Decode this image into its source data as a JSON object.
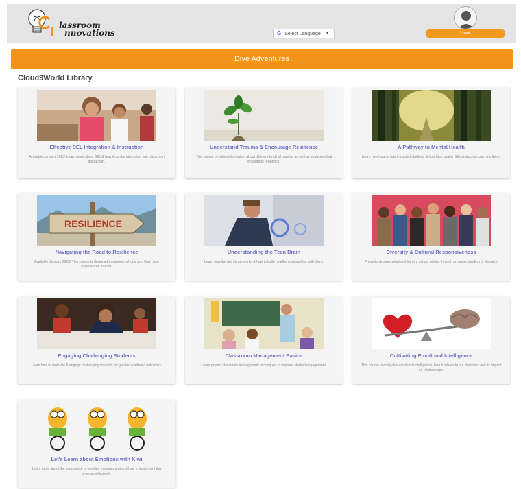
{
  "header": {
    "logo_text_line1": "lassroom",
    "logo_text_line2": "nnovations",
    "language_label": "Select Language",
    "language_caret": "▼",
    "language_icon_letter": "G",
    "user_button_label": "User"
  },
  "banner": {
    "label": "Dive Adventures"
  },
  "library": {
    "title": "Cloud9World Library"
  },
  "courses": [
    {
      "title": "Effective SEL Integration & Instruction",
      "description": "Available January 2023! Learn more about SEL & how it can be integrated into classroom instruction."
    },
    {
      "title": "Understand Trauma & Encourage Resilience",
      "description": "This course provides information about different kinds of trauma, as well as strategies that encourage resilience."
    },
    {
      "title": "A Pathway to Mental Health",
      "description": "Learn how trauma has impacted students & how high quality SEL instruction can help them."
    },
    {
      "title": "Navigating the Road to Resilience",
      "description": "Available January 2023! This course is designed to support schools and they have experienced trauma."
    },
    {
      "title": "Understanding the Teen Brain",
      "description": "Learn how the teen brain works & how to build healthy relationships with them."
    },
    {
      "title": "Diversity & Cultural Responsiveness",
      "description": "Promote stronger relationships in a school setting through an understanding of diversity."
    },
    {
      "title": "Engaging Challenging Students",
      "description": "Learn how to motivate & engage challenging students for greater academic outcomes."
    },
    {
      "title": "Classroom Management Basics",
      "description": "Learn proven classroom management techniques to improve student engagement."
    },
    {
      "title": "Cultivating Emotional Intelligence",
      "description": "This course investigates emotional intelligence, how it relates to our decisions and its impact on relationships."
    },
    {
      "title": "Let's Learn about Emotions with Kiwi",
      "description": "Learn more about the importance of emotion management and how to implement this program effectively."
    }
  ],
  "thumb_text": {
    "resilience_sign": "RESILIENCE"
  },
  "colors": {
    "accent": "#f3931a",
    "course_title": "#7372c4",
    "topbar": "#e4e4e4"
  }
}
